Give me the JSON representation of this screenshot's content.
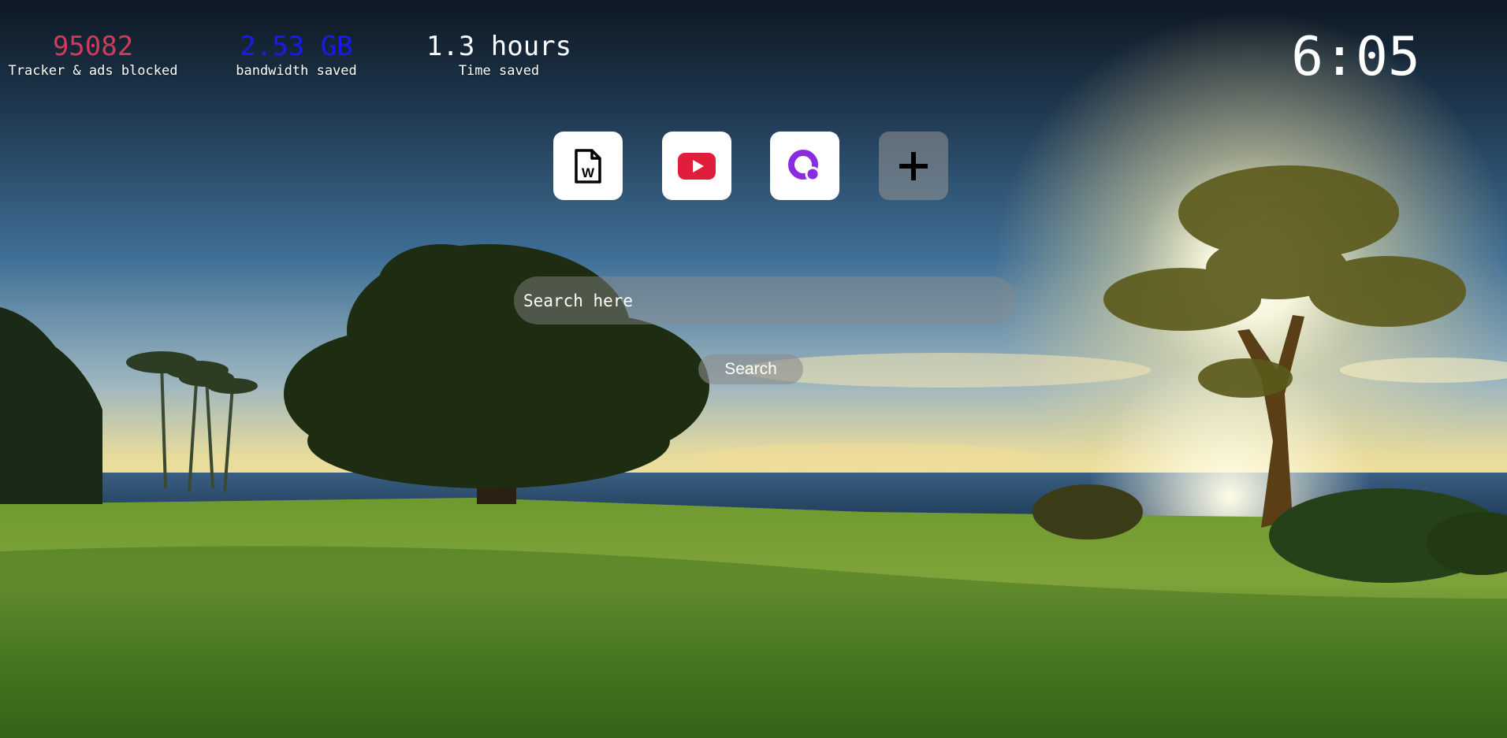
{
  "stats": {
    "trackers": {
      "value": "95082",
      "label": "Tracker & ads blocked",
      "color": "#d13a5a"
    },
    "bandwidth": {
      "value": "2.53 GB",
      "label": "bandwidth saved",
      "color": "#1a1aee"
    },
    "time": {
      "value": "1.3 hours",
      "label": "Time saved",
      "color": "#ffffff"
    }
  },
  "clock": "6:05",
  "shortcuts": [
    {
      "icon": "word-document-icon"
    },
    {
      "icon": "youtube-icon",
      "color": "#e01e3c"
    },
    {
      "icon": "purple-ring-icon",
      "color": "#8a2be2"
    },
    {
      "icon": "plus-icon"
    }
  ],
  "search": {
    "placeholder": "Search here",
    "button_label": "Search"
  },
  "background": {
    "sky_top": "#0c1620",
    "sky_mid": "#3d6d94",
    "horizon_glow": "#fff6c8",
    "sea": "#2a4d72",
    "grass": "#5b8a2a"
  }
}
